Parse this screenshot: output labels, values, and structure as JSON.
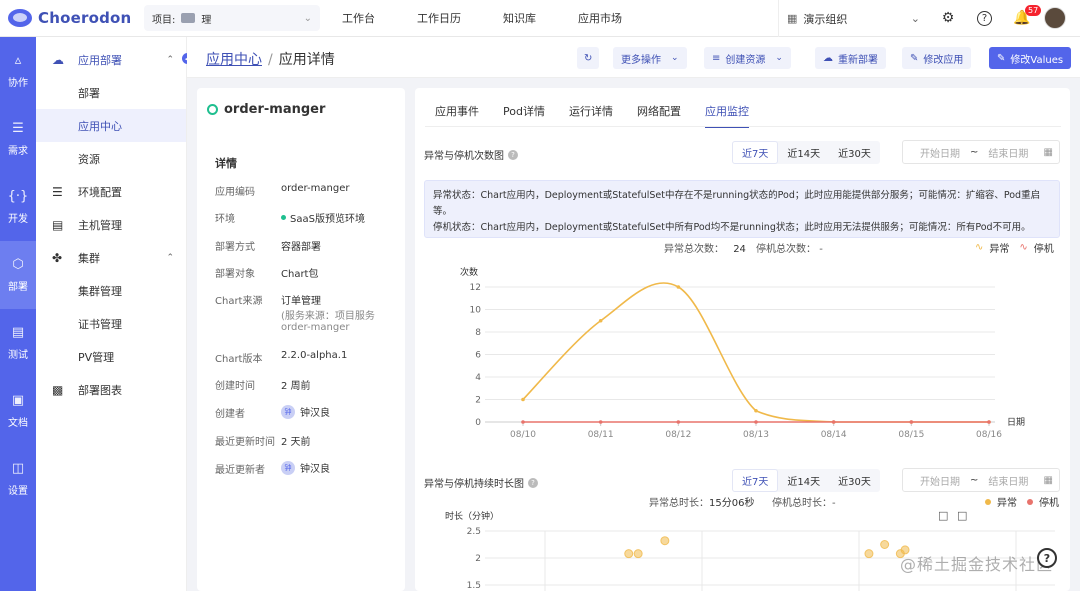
{
  "brand": {
    "name": "Choerodon"
  },
  "project": {
    "prefix": "项目:",
    "suffix": "理"
  },
  "topnav": [
    "工作台",
    "工作日历",
    "知识库",
    "应用市场"
  ],
  "org": {
    "name": "演示组织"
  },
  "notifications": {
    "count": "57"
  },
  "rail": [
    "协作",
    "需求",
    "开发",
    "部署",
    "测试",
    "文档",
    "设置"
  ],
  "sidebar": {
    "group_deploy": "应用部署",
    "deploy_items": [
      "部署",
      "应用中心",
      "资源"
    ],
    "env_config": "环境配置",
    "host_mgmt": "主机管理",
    "cluster": "集群",
    "cluster_items": [
      "集群管理",
      "证书管理",
      "PV管理"
    ],
    "charts": "部署图表"
  },
  "breadcrumb": {
    "parent": "应用中心",
    "current": "应用详情"
  },
  "actions": {
    "more": "更多操作",
    "create": "创建资源",
    "redeploy": "重新部署",
    "modify_app": "修改应用",
    "modify_values": "修改Values"
  },
  "app": {
    "name": "order-manger",
    "section_title": "详情",
    "labels": [
      "应用编码",
      "环境",
      "部署方式",
      "部署对象",
      "Chart来源",
      "Chart版本",
      "创建时间",
      "创建者",
      "最近更新时间",
      "最近更新者"
    ],
    "code": "order-manger",
    "env": "SaaS版预览环境",
    "deploy_mode": "容器部署",
    "deploy_target": "Chart包",
    "chart_source": "订单管理",
    "chart_source_sub1": "(服务来源：项目服务",
    "chart_source_sub2": "order-manger",
    "chart_version": "2.2.0-alpha.1",
    "created": "2 周前",
    "creator": "钟汉良",
    "creator_avatar": "钟",
    "updated": "2 天前",
    "updater": "钟汉良",
    "updater_avatar": "钟"
  },
  "tabs": [
    "应用事件",
    "Pod详情",
    "运行详情",
    "网络配置",
    "应用监控"
  ],
  "monitor": {
    "chart1_title": "异常与停机次数图",
    "chart2_title": "异常与停机持续时长图",
    "ranges": [
      "近7天",
      "近14天",
      "近30天"
    ],
    "date_start": "开始日期",
    "date_sep": "~",
    "date_end": "结束日期",
    "notice1": "异常状态：Chart应用内，Deployment或StatefulSet中存在不是running状态的Pod；此时应用能提供部分服务；可能情况：扩缩容、Pod重启等。",
    "notice2": "停机状态：Chart应用内，Deployment或StatefulSet中所有Pod均不是running状态；此时应用无法提供服务；可能情况：所有Pod不可用。",
    "abnormal_count_label": "异常总次数：",
    "abnormal_count": "24",
    "down_count_label": "停机总次数：",
    "down_count": "-",
    "abnormal_dur_label": "异常总时长：",
    "abnormal_dur": "15分06秒",
    "down_dur_label": "停机总时长：",
    "down_dur": "-",
    "legend_abnormal": "异常",
    "legend_down": "停机"
  },
  "watermark": "@稀土掘金技术社区",
  "colors": {
    "primary": "#5365ea",
    "abnormal": "#f0b94a",
    "down": "#e8736c",
    "env_dot": "#1fbf8f"
  },
  "chart_data": [
    {
      "type": "line",
      "title": "异常与停机次数图",
      "ylabel": "次数",
      "xlabel": "日期",
      "x": [
        "08/10",
        "08/11",
        "08/12",
        "08/13",
        "08/14",
        "08/15",
        "08/16"
      ],
      "ylim": [
        0,
        12
      ],
      "yticks": [
        0,
        2,
        4,
        6,
        8,
        10,
        12
      ],
      "series": [
        {
          "name": "异常",
          "values": [
            2,
            9,
            12,
            1,
            0,
            0,
            0
          ]
        },
        {
          "name": "停机",
          "values": [
            0,
            0,
            0,
            0,
            0,
            0,
            0
          ]
        }
      ],
      "legend": "top-right"
    },
    {
      "type": "scatter",
      "title": "异常与停机持续时长图",
      "ylabel": "时长（分钟）",
      "yticks": [
        1.5,
        2,
        2.5
      ],
      "series": [
        {
          "name": "异常",
          "points": [
            [
              0.82,
              2.08
            ],
            [
              0.88,
              2.08
            ],
            [
              1.05,
              2.32
            ],
            [
              2.35,
              2.08
            ],
            [
              2.45,
              2.25
            ],
            [
              2.55,
              2.08
            ],
            [
              2.58,
              2.15
            ]
          ]
        },
        {
          "name": "停机",
          "points": []
        }
      ],
      "legend": "top-right"
    }
  ]
}
